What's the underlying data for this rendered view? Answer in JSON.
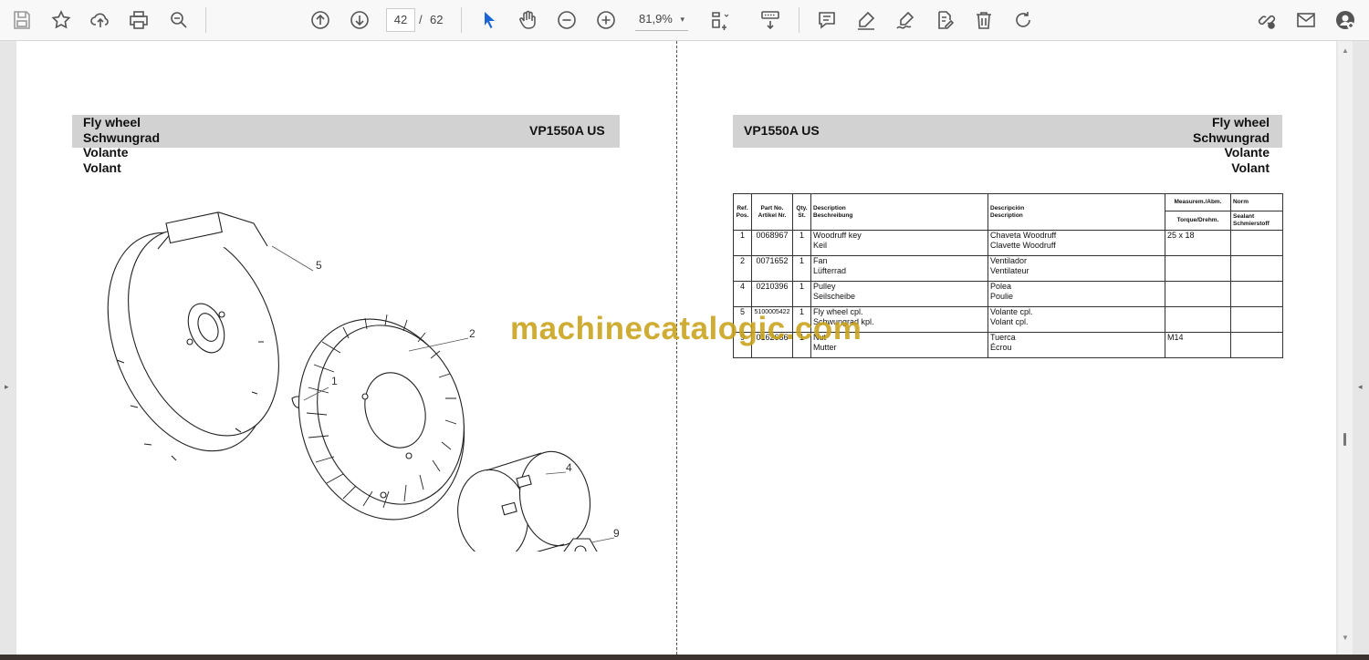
{
  "toolbar": {
    "page_current": "42",
    "page_separator": "/",
    "page_total": "62",
    "zoom": "81,9%",
    "zoom_caret": "▾",
    "icons": [
      "save-icon",
      "bookmark-star-icon",
      "upload-icon",
      "print-icon",
      "zoom-search-icon",
      "page-up-icon",
      "page-down-icon",
      "select-cursor-icon",
      "hand-pan-icon",
      "zoom-out-icon",
      "zoom-in-icon",
      "zoom-caret-icon",
      "page-fit-icon",
      "scroll-mode-icon",
      "comment-icon",
      "highlight-icon",
      "draw-icon",
      "edit-pdf-icon",
      "delete-icon",
      "rotate-icon",
      "share-link-icon",
      "email-icon",
      "account-icon"
    ]
  },
  "left_page": {
    "header_lines": [
      "Fly wheel",
      "Schwungrad",
      "Volante",
      "Volant"
    ],
    "model": "VP1550A US",
    "callouts": [
      "5",
      "2",
      "1",
      "4",
      "9"
    ]
  },
  "right_page": {
    "model": "VP1550A US",
    "header_lines": [
      "Fly wheel",
      "Schwungrad",
      "Volante",
      "Volant"
    ],
    "table": {
      "head": {
        "ref": "Ref.",
        "pos": "Pos.",
        "part": "Part No.",
        "artikel": "Artikel Nr.",
        "qty": "Qty.",
        "st": "St.",
        "desc_en": "Description",
        "desc_de": "Beschreibung",
        "desc_es": "Descripción",
        "desc_fr": "Description",
        "measure": "Measurem./Abm.",
        "torque": "Torque/Drehm.",
        "norm": "Norm",
        "sealant": "Sealant",
        "schmier": "Schmierstoff"
      },
      "rows": [
        {
          "pos": "1",
          "part": "0068967",
          "qty": "1",
          "d1": "Woodruff key",
          "d2": "Keil",
          "e1": "Chaveta Woodruff",
          "e2": "Clavette Woodruff",
          "measure": "25 x 18",
          "norm": ""
        },
        {
          "pos": "2",
          "part": "0071652",
          "qty": "1",
          "d1": "Fan",
          "d2": "Lüfterrad",
          "e1": "Ventilador",
          "e2": "Ventilateur",
          "measure": "",
          "norm": ""
        },
        {
          "pos": "4",
          "part": "0210396",
          "qty": "1",
          "d1": "Pulley",
          "d2": "Seilscheibe",
          "e1": "Polea",
          "e2": "Poulie",
          "measure": "",
          "norm": ""
        },
        {
          "pos": "5",
          "part": "5100005422",
          "qty": "1",
          "d1": "Fly wheel cpl.",
          "d2": "Schwungrad kpl.",
          "e1": "Volante cpl.",
          "e2": "Volant cpl.",
          "measure": "",
          "norm": ""
        },
        {
          "pos": "9",
          "part": "0162686",
          "qty": "1",
          "d1": "Nut",
          "d2": "Mutter",
          "e1": "Tuerca",
          "e2": "Écrou",
          "measure": "M14",
          "norm": ""
        }
      ]
    }
  },
  "watermark": "machinecatalogic.com",
  "nav": {
    "left_arrow": "▸",
    "right_arrow": "◂",
    "scroll_up": "▲",
    "scroll_down": "▼"
  }
}
